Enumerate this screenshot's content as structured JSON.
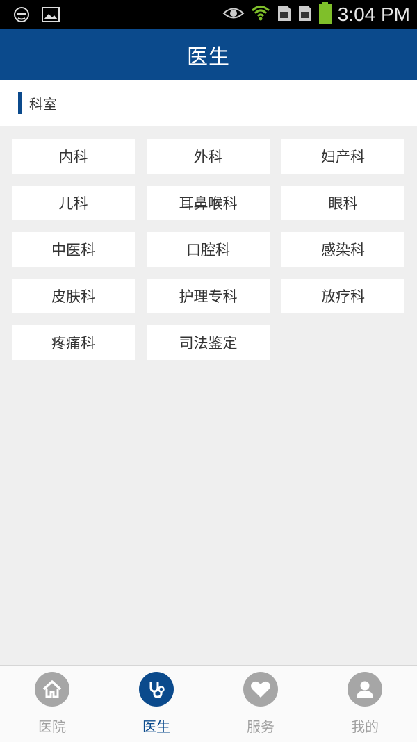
{
  "status_bar": {
    "time": "3:04 PM",
    "icons": [
      "ghost-icon",
      "image-icon",
      "eye-icon",
      "wifi-icon",
      "sim-card-icon",
      "sim-card-icon",
      "battery-icon"
    ]
  },
  "header": {
    "title": "医生"
  },
  "section": {
    "label": "科室"
  },
  "departments": [
    {
      "label": "内科"
    },
    {
      "label": "外科"
    },
    {
      "label": "妇产科"
    },
    {
      "label": "儿科"
    },
    {
      "label": "耳鼻喉科"
    },
    {
      "label": "眼科"
    },
    {
      "label": "中医科"
    },
    {
      "label": "口腔科"
    },
    {
      "label": "感染科"
    },
    {
      "label": "皮肤科"
    },
    {
      "label": "护理专科"
    },
    {
      "label": "放疗科"
    },
    {
      "label": "疼痛科"
    },
    {
      "label": "司法鉴定"
    }
  ],
  "bottom_nav": [
    {
      "label": "医院",
      "icon": "home-icon",
      "active": false
    },
    {
      "label": "医生",
      "icon": "stethoscope-icon",
      "active": true
    },
    {
      "label": "服务",
      "icon": "heart-icon",
      "active": false
    },
    {
      "label": "我的",
      "icon": "user-icon",
      "active": false
    }
  ],
  "colors": {
    "brand": "#0b4a8c",
    "inactive": "#a6a6a6",
    "background": "#efefef"
  }
}
